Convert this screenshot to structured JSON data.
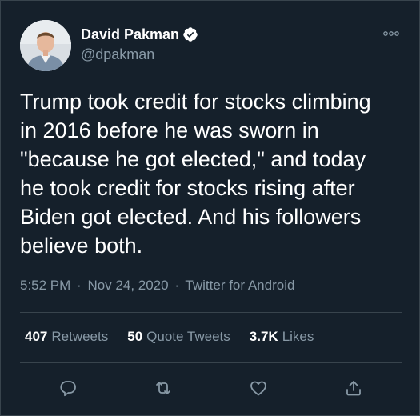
{
  "author": {
    "display_name": "David Pakman",
    "handle": "@dpakman",
    "verified": true
  },
  "tweet": {
    "text": "Trump took credit for stocks climbing\nin 2016 before he was sworn in\n\"because he got elected,\" and today\nhe took credit for stocks rising after\nBiden got elected. And his followers\nbelieve both.",
    "time": "5:52 PM",
    "date": "Nov 24, 2020",
    "source": "Twitter for Android",
    "separator": "·"
  },
  "stats": {
    "retweets_count": "407",
    "retweets_label": "Retweets",
    "quotes_count": "50",
    "quotes_label": "Quote Tweets",
    "likes_count": "3.7K",
    "likes_label": "Likes"
  },
  "icons": {
    "more": "more-icon",
    "reply": "reply-icon",
    "retweet": "retweet-icon",
    "like": "heart-icon",
    "share": "share-icon",
    "verified": "verified-badge-icon"
  },
  "colors": {
    "background": "#15202b",
    "border": "#38444d",
    "secondary_text": "#8899a6",
    "primary_text": "#ffffff"
  }
}
